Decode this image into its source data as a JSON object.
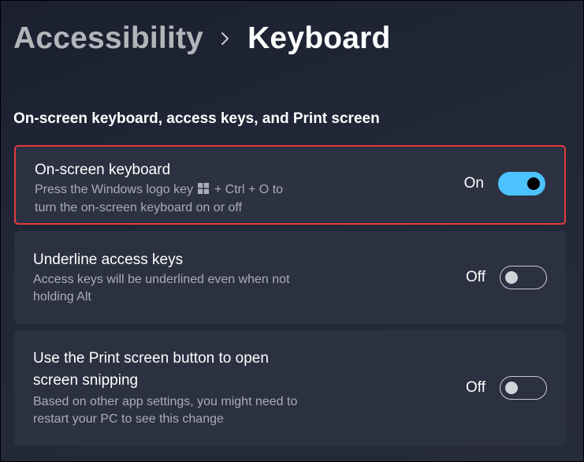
{
  "breadcrumb": {
    "parent": "Accessibility",
    "separator_icon": "chevron-right-icon",
    "current": "Keyboard"
  },
  "section": {
    "title": "On-screen keyboard, access keys, and Print screen"
  },
  "settings": [
    {
      "title": "On-screen keyboard",
      "desc_line1_pre": "Press the Windows logo key",
      "desc_line1_icon": "windows-logo-icon",
      "desc_line1_post": "+ Ctrl + O to",
      "desc_line2": "turn the on-screen keyboard on or off",
      "state_label": "On",
      "enabled": true,
      "highlighted": true
    },
    {
      "title": "Underline access keys",
      "desc_line1": "Access keys will be underlined even when not",
      "desc_line2": "holding Alt",
      "state_label": "Off",
      "enabled": false
    },
    {
      "title_line1": "Use the Print screen button to open",
      "title_line2": "screen snipping",
      "desc_line1": "Based on other app settings, you might need to",
      "desc_line2": "restart your PC to see this change",
      "state_label": "Off",
      "enabled": false
    }
  ],
  "colors": {
    "accent": "#4cc2ff",
    "highlight_border": "#e23b3b",
    "card_bg": "#2b3141"
  }
}
